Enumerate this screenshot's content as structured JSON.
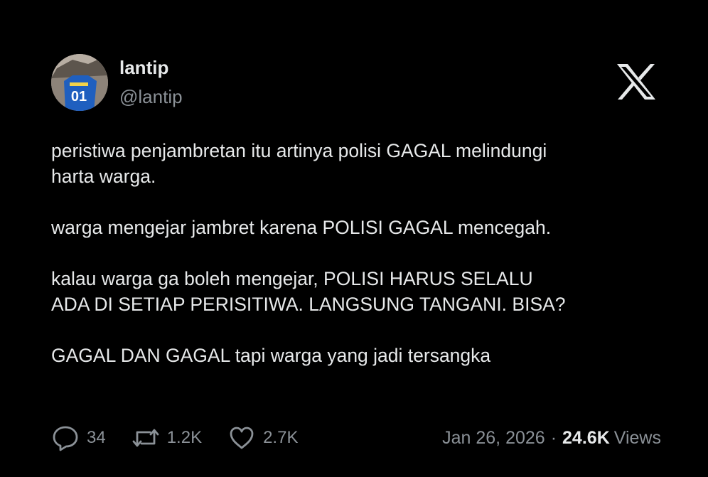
{
  "author": {
    "display_name": "lantip",
    "handle": "@lantip",
    "avatar_jersey_number": "01"
  },
  "platform_logo": "x-logo-icon",
  "post": {
    "paragraphs": [
      "peristiwa penjambretan itu artinya polisi GAGAL melindungi\nharta warga.",
      "warga mengejar jambret karena POLISI GAGAL mencegah.",
      "kalau warga ga boleh mengejar, POLISI HARUS SELALU\nADA DI SETIAP PERISITIWA. LANGSUNG TANGANI. BISA?",
      "GAGAL DAN GAGAL tapi warga yang jadi tersangka"
    ]
  },
  "stats": {
    "replies": "34",
    "reposts": "1.2K",
    "likes": "2.7K"
  },
  "meta": {
    "date": "Jan 26, 2026",
    "separator": "·",
    "views_count": "24.6K",
    "views_label": "Views"
  },
  "colors": {
    "background": "#000000",
    "text_primary": "#e7e9ea",
    "text_secondary": "#8b9197"
  }
}
